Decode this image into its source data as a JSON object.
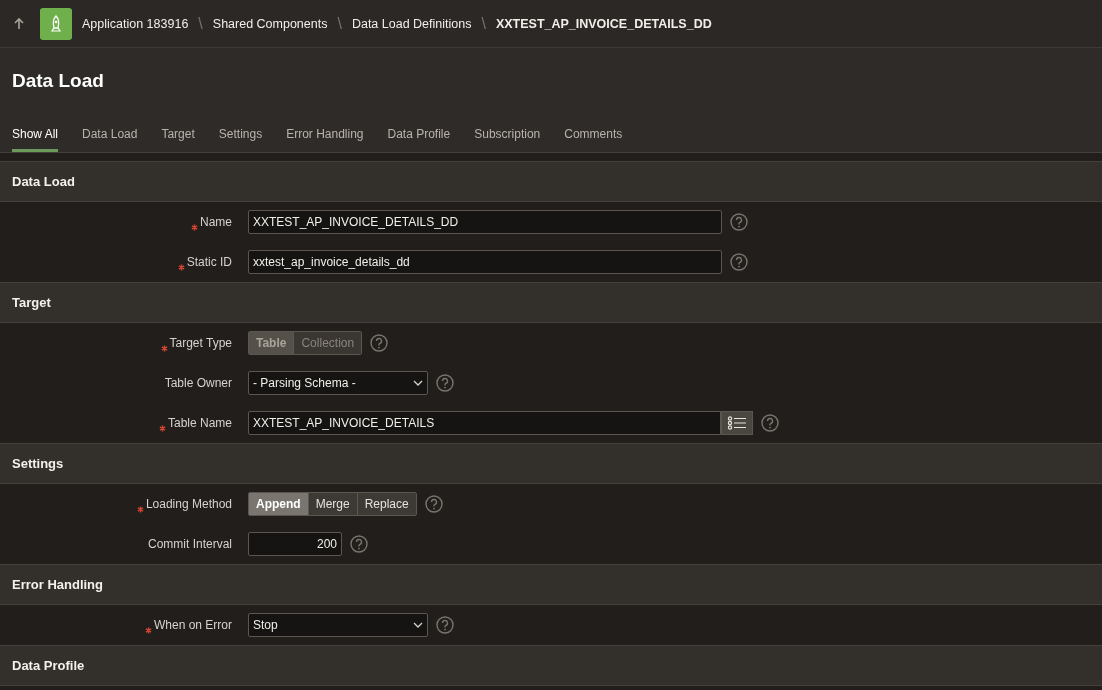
{
  "breadcrumb": {
    "items": [
      "Application 183916",
      "Shared Components",
      "Data Load Definitions",
      "XXTEST_AP_INVOICE_DETAILS_DD"
    ],
    "separator": "\\"
  },
  "page_title": "Data Load",
  "tabs": [
    {
      "label": "Show All",
      "selected": true
    },
    {
      "label": "Data Load",
      "selected": false
    },
    {
      "label": "Target",
      "selected": false
    },
    {
      "label": "Settings",
      "selected": false
    },
    {
      "label": "Error Handling",
      "selected": false
    },
    {
      "label": "Data Profile",
      "selected": false
    },
    {
      "label": "Subscription",
      "selected": false
    },
    {
      "label": "Comments",
      "selected": false
    }
  ],
  "sections": [
    {
      "title": "Data Load",
      "fields": [
        {
          "kind": "text",
          "label": "Name",
          "required": true,
          "value": "XXTEST_AP_INVOICE_DETAILS_DD"
        },
        {
          "kind": "text",
          "label": "Static ID",
          "required": true,
          "value": "xxtest_ap_invoice_details_dd"
        }
      ]
    },
    {
      "title": "Target",
      "fields": [
        {
          "kind": "segmented",
          "label": "Target Type",
          "required": true,
          "disabled": true,
          "options": [
            {
              "label": "Table",
              "selected": true
            },
            {
              "label": "Collection",
              "selected": false
            }
          ]
        },
        {
          "kind": "select",
          "label": "Table Owner",
          "required": false,
          "value": "- Parsing Schema -"
        },
        {
          "kind": "lov",
          "label": "Table Name",
          "required": true,
          "value": "XXTEST_AP_INVOICE_DETAILS"
        }
      ]
    },
    {
      "title": "Settings",
      "fields": [
        {
          "kind": "segmented",
          "label": "Loading Method",
          "required": true,
          "disabled": false,
          "options": [
            {
              "label": "Append",
              "selected": true
            },
            {
              "label": "Merge",
              "selected": false
            },
            {
              "label": "Replace",
              "selected": false
            }
          ]
        },
        {
          "kind": "number",
          "label": "Commit Interval",
          "required": false,
          "value": "200"
        }
      ]
    },
    {
      "title": "Error Handling",
      "fields": [
        {
          "kind": "select",
          "label": "When on Error",
          "required": true,
          "value": "Stop"
        }
      ]
    },
    {
      "title": "Data Profile"
    }
  ]
}
